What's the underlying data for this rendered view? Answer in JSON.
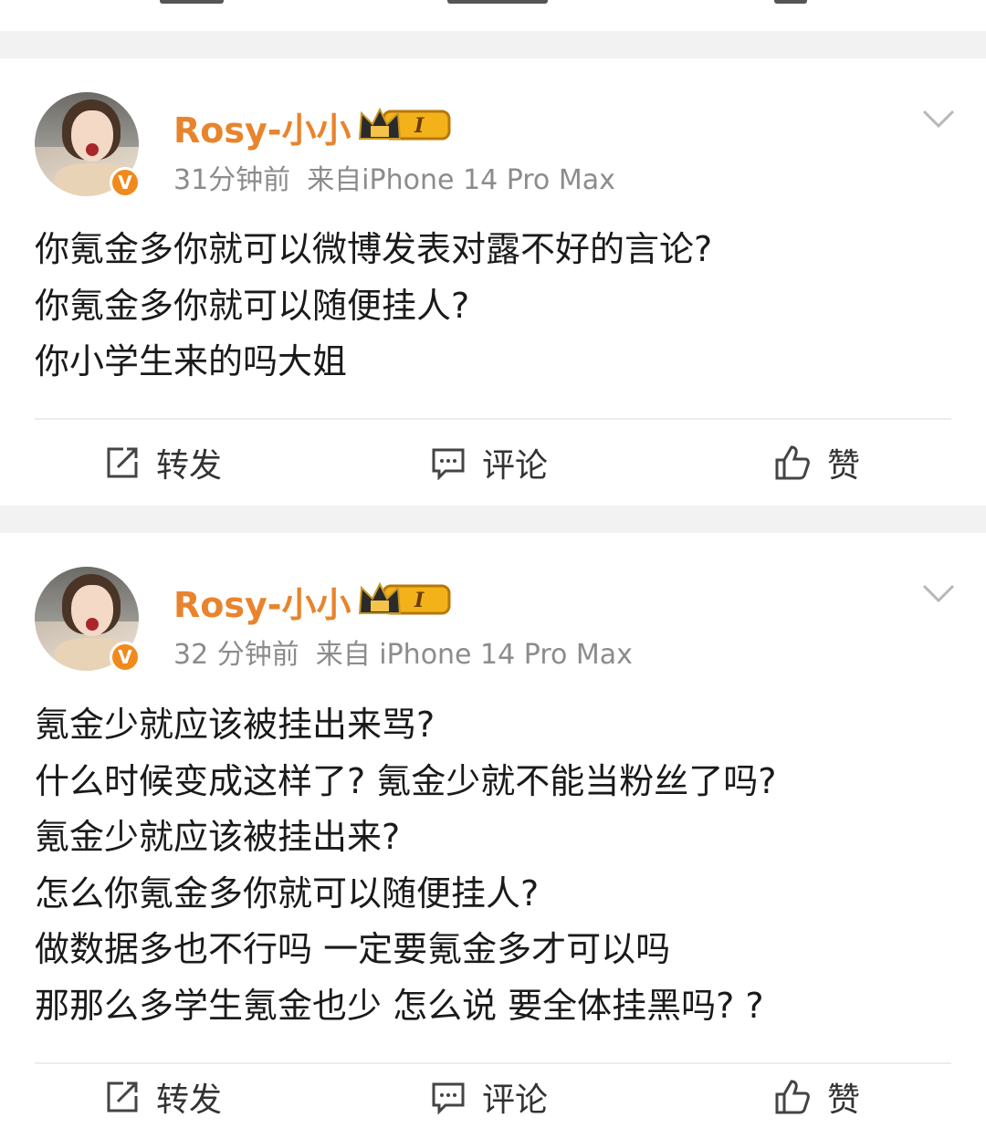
{
  "posts": [
    {
      "username": "Rosy-小小",
      "verified_badge": "V",
      "time": "31分钟前",
      "source": "来自iPhone 14 Pro Max",
      "lines": [
        "你氪金多你就可以微博发表对露不好的言论?",
        "你氪金多你就可以随便挂人?",
        "你小学生来的吗大姐"
      ],
      "actions": {
        "repost": "转发",
        "comment": "评论",
        "like": "赞"
      }
    },
    {
      "username": "Rosy-小小",
      "verified_badge": "V",
      "time": "32 分钟前",
      "source": "来自 iPhone 14 Pro Max",
      "lines": [
        "氪金少就应该被挂出来骂?",
        "什么时候变成这样了?  氪金少就不能当粉丝了吗?",
        "氪金少就应该被挂出来?",
        "怎么你氪金多你就可以随便挂人?",
        "做数据多也不行吗 一定要氪金多才可以吗",
        "那那么多学生氪金也少  怎么说  要全体挂黑吗? ?"
      ],
      "actions": {
        "repost": "转发",
        "comment": "评论",
        "like": "赞"
      }
    }
  ],
  "icons": {
    "avatar": "avatar-photo",
    "verified": "verified-v-icon",
    "level": "crown-level-icon",
    "more": "chevron-down-icon",
    "repost": "repost-icon",
    "comment": "comment-icon",
    "like": "thumbs-up-icon"
  },
  "colors": {
    "username": "#e8842d",
    "meta": "#8c8c8c",
    "separator": "#f2f2f2",
    "verified": "#f08a1d"
  }
}
